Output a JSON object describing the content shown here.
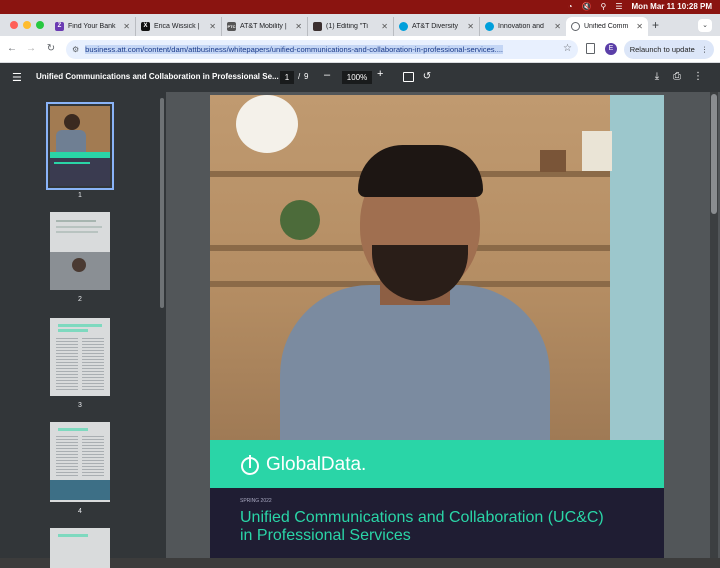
{
  "menubar": {
    "datetime": "Mon Mar 11  10:28 PM"
  },
  "tabs": [
    {
      "label": "Find Your Bank",
      "favicon": "Z",
      "color": "#6a3ab2"
    },
    {
      "label": "Erica Wissick |",
      "favicon": "X",
      "color": "#111111"
    },
    {
      "label": "AT&T Mobility |",
      "favicon": "PTC",
      "color": "#555555"
    },
    {
      "label": "(1) Editing \"Ti",
      "favicon": "(",
      "color": "#3b2f2f"
    },
    {
      "label": "AT&T Diversity",
      "favicon": "att",
      "color": "#009fdb"
    },
    {
      "label": "Innovation and",
      "favicon": "att",
      "color": "#009fdb"
    },
    {
      "label": "Unified Comm",
      "favicon": "globe",
      "color": "#5f6368"
    }
  ],
  "toolbar": {
    "url": "business.att.com/content/dam/attbusiness/whitepapers/unified-communications-and-collaboration-in-professional-services....",
    "profile_initial": "E",
    "relaunch_label": "Relaunch to update"
  },
  "pdf": {
    "title": "Unified Communications and Collaboration in Professional Se...",
    "current_page": "1",
    "page_sep": "/",
    "total_pages": "9",
    "zoom": "100%"
  },
  "thumbnails": [
    "1",
    "2",
    "3",
    "4"
  ],
  "cover": {
    "brand": "GlobalData.",
    "season": "SPRING 2022",
    "title": "Unified Communications and Collaboration (UC&C) in Professional Services"
  },
  "colors": {
    "accent": "#2ad5a7",
    "menubar": "#8a1410",
    "pdf_toolbar": "#323639"
  }
}
